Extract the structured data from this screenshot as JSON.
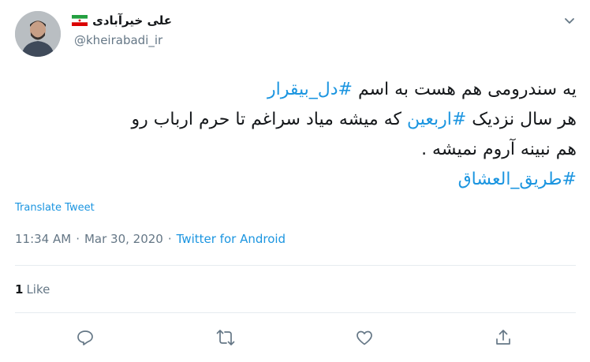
{
  "author": {
    "display_name": "علی خیرآبادی",
    "handle": "@kheirabadi_ir",
    "flag": "iran-flag-emoji"
  },
  "tweet": {
    "lines": [
      [
        {
          "text": "یه سندرومی هم هست به اسم ",
          "type": "text"
        },
        {
          "text": "#دل_بیقرار",
          "type": "hashtag"
        }
      ],
      [
        {
          "text": "هر سال نزدیک ",
          "type": "text"
        },
        {
          "text": "#اربعین",
          "type": "hashtag"
        },
        {
          "text": " که میشه میاد سراغم تا حرم ارباب رو",
          "type": "text"
        }
      ],
      [
        {
          "text": "هم نبینه آروم نمیشه .",
          "type": "text"
        }
      ],
      [
        {
          "text": "#طریق_العشاق",
          "type": "hashtag"
        }
      ]
    ],
    "translate_label": "Translate Tweet",
    "time": "11:34 AM",
    "separator": "·",
    "date": "Mar 30, 2020",
    "source": "Twitter for Android"
  },
  "stats": {
    "likes_count": "1",
    "likes_label": "Like"
  },
  "actions": [
    {
      "name": "reply",
      "icon": "reply-icon"
    },
    {
      "name": "retweet",
      "icon": "retweet-icon"
    },
    {
      "name": "like",
      "icon": "heart-icon"
    },
    {
      "name": "share",
      "icon": "share-icon"
    }
  ],
  "colors": {
    "link": "#1b95e0",
    "secondary_text": "#657786",
    "primary_text": "#14171a",
    "divider": "#e6ecf0"
  }
}
